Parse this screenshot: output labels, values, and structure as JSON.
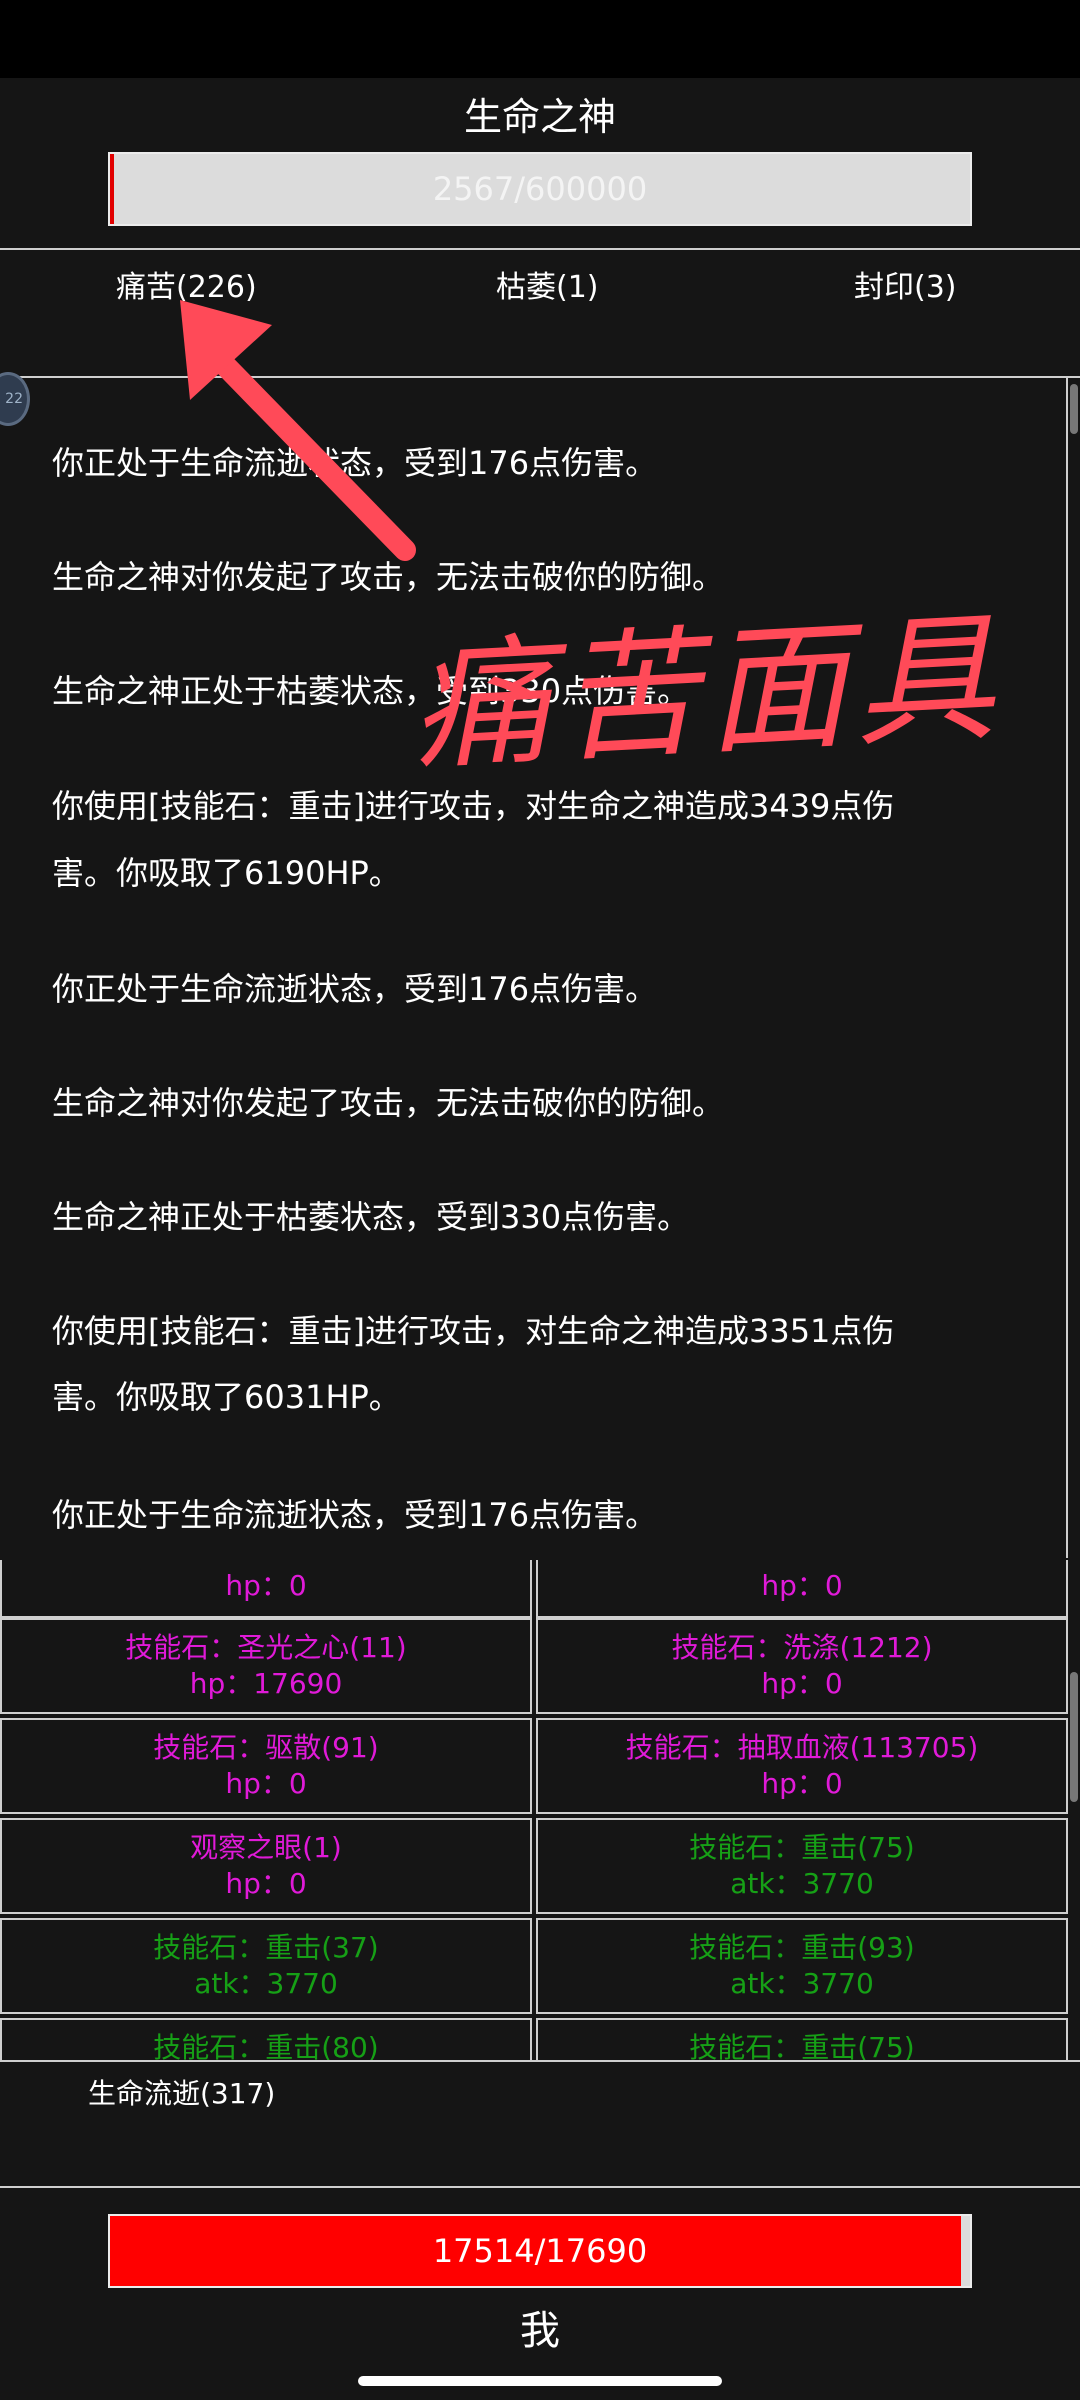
{
  "boss": {
    "name": "生命之神",
    "hp_text": "2567/600000",
    "hp_fraction": 0.0043
  },
  "status_tabs": [
    "痛苦(226)",
    "枯萎(1)",
    "封印(3)"
  ],
  "log": [
    "你正处于生命流逝状态，受到176点伤害。",
    "生命之神对你发起了攻击，无法击破你的防御。",
    "生命之神正处于枯萎状态，受到330点伤害。",
    "你使用[技能石：重击]进行攻击，对生命之神造成3439点伤",
    "害。你吸取了6190HP。",
    "你正处于生命流逝状态，受到176点伤害。",
    "生命之神对你发起了攻击，无法击破你的防御。",
    "生命之神正处于枯萎状态，受到330点伤害。",
    "你使用[技能石：重击]进行攻击，对生命之神造成3351点伤",
    "害。你吸取了6031HP。",
    "你正处于生命流逝状态，受到176点伤害。"
  ],
  "items": [
    {
      "name": "",
      "stat": "hp：0",
      "color": "magenta"
    },
    {
      "name": "",
      "stat": "hp：0",
      "color": "magenta"
    },
    {
      "name": "技能石：圣光之心(11)",
      "stat": "hp：17690",
      "color": "magenta"
    },
    {
      "name": "技能石：洗涤(1212)",
      "stat": "hp：0",
      "color": "magenta"
    },
    {
      "name": "技能石：驱散(91)",
      "stat": "hp：0",
      "color": "magenta"
    },
    {
      "name": "技能石：抽取血液(113705)",
      "stat": "hp：0",
      "color": "magenta"
    },
    {
      "name": "观察之眼(1)",
      "stat": "hp：0",
      "color": "magenta"
    },
    {
      "name": "技能石：重击(75)",
      "stat": "atk：3770",
      "color": "green"
    },
    {
      "name": "技能石：重击(37)",
      "stat": "atk：3770",
      "color": "green"
    },
    {
      "name": "技能石：重击(93)",
      "stat": "atk：3770",
      "color": "green"
    },
    {
      "name": "技能石：重击(80)",
      "stat": "",
      "color": "green"
    },
    {
      "name": "技能石：重击(75)",
      "stat": "",
      "color": "green"
    }
  ],
  "player_buff": "生命流逝(317)",
  "player": {
    "name": "我",
    "hp_text": "17514/17690",
    "hp_fraction": 0.9901
  },
  "annotation": {
    "text": "痛苦面具",
    "color": "#ff4a58"
  },
  "colors": {
    "magenta": "#e01ad8",
    "green": "#16a016",
    "hp_red": "#ff0000"
  },
  "side_badge": "22"
}
